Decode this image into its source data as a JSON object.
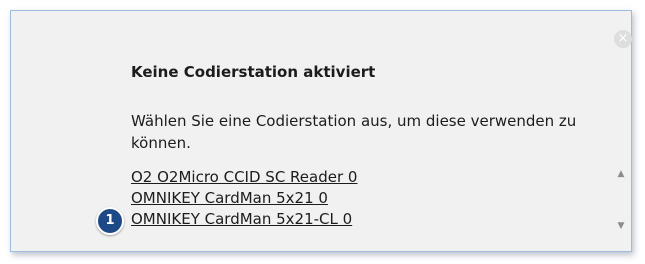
{
  "dialog": {
    "title": "Keine Codierstation aktiviert",
    "message": "Wählen Sie eine Codierstation aus, um diese verwenden zu können.",
    "close_glyph": "×"
  },
  "stations": [
    {
      "label": "O2 O2Micro CCID SC Reader 0"
    },
    {
      "label": "OMNIKEY CardMan 5x21 0"
    },
    {
      "label": "OMNIKEY CardMan 5x21-CL 0"
    }
  ],
  "scrollbar": {
    "up_glyph": "▲",
    "down_glyph": "▼"
  },
  "callout": {
    "number": "1",
    "color": "#1d4a86"
  }
}
